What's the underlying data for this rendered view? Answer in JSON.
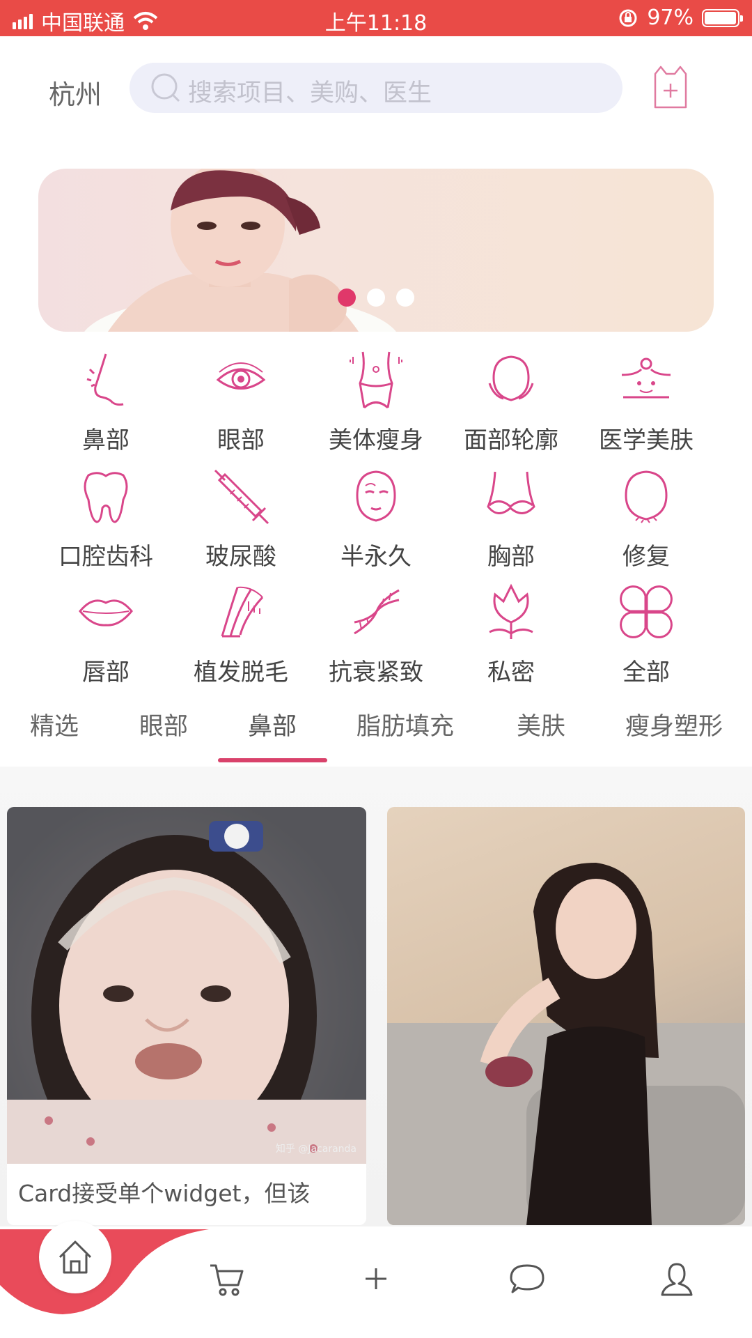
{
  "status_bar": {
    "carrier": "中国联通",
    "time": "上午11:18",
    "battery": "97%",
    "battery_level": 0.97
  },
  "header": {
    "city": "杭州",
    "search_placeholder": "搜索项目、美购、医生"
  },
  "banner": {
    "dots": 3,
    "active_index": 0
  },
  "categories": [
    {
      "label": "鼻部",
      "icon": "nose-icon"
    },
    {
      "label": "眼部",
      "icon": "eye-icon"
    },
    {
      "label": "美体瘦身",
      "icon": "body-icon"
    },
    {
      "label": "面部轮廓",
      "icon": "face-contour-icon"
    },
    {
      "label": "医学美肤",
      "icon": "skin-icon"
    },
    {
      "label": "口腔齿科",
      "icon": "tooth-icon"
    },
    {
      "label": "玻尿酸",
      "icon": "syringe-icon"
    },
    {
      "label": "半永久",
      "icon": "makeup-face-icon"
    },
    {
      "label": "胸部",
      "icon": "bra-icon"
    },
    {
      "label": "修复",
      "icon": "repair-face-icon"
    },
    {
      "label": "唇部",
      "icon": "lips-icon"
    },
    {
      "label": "植发脱毛",
      "icon": "hair-icon"
    },
    {
      "label": "抗衰紧致",
      "icon": "dna-icon"
    },
    {
      "label": "私密",
      "icon": "flower-icon"
    },
    {
      "label": "全部",
      "icon": "clover-icon"
    }
  ],
  "tabs": [
    {
      "label": "精选"
    },
    {
      "label": "眼部"
    },
    {
      "label": "鼻部",
      "active": true
    },
    {
      "label": "脂肪填充"
    },
    {
      "label": "美肤"
    },
    {
      "label": "瘦身塑形"
    }
  ],
  "feed": {
    "cards": [
      {
        "text": "Card接受单个widget，但该",
        "watermark": "知乎 @Jacaranda"
      },
      {
        "text": ""
      }
    ]
  },
  "bottom_nav": [
    {
      "name": "home",
      "icon": "home-icon",
      "active": true
    },
    {
      "name": "cart",
      "icon": "cart-icon"
    },
    {
      "name": "add",
      "icon": "plus-icon"
    },
    {
      "name": "message",
      "icon": "chat-icon"
    },
    {
      "name": "profile",
      "icon": "user-icon"
    }
  ],
  "colors": {
    "accent": "#e0386a",
    "status_bar": "#e94b47",
    "icon_pink": "#d9468a"
  }
}
